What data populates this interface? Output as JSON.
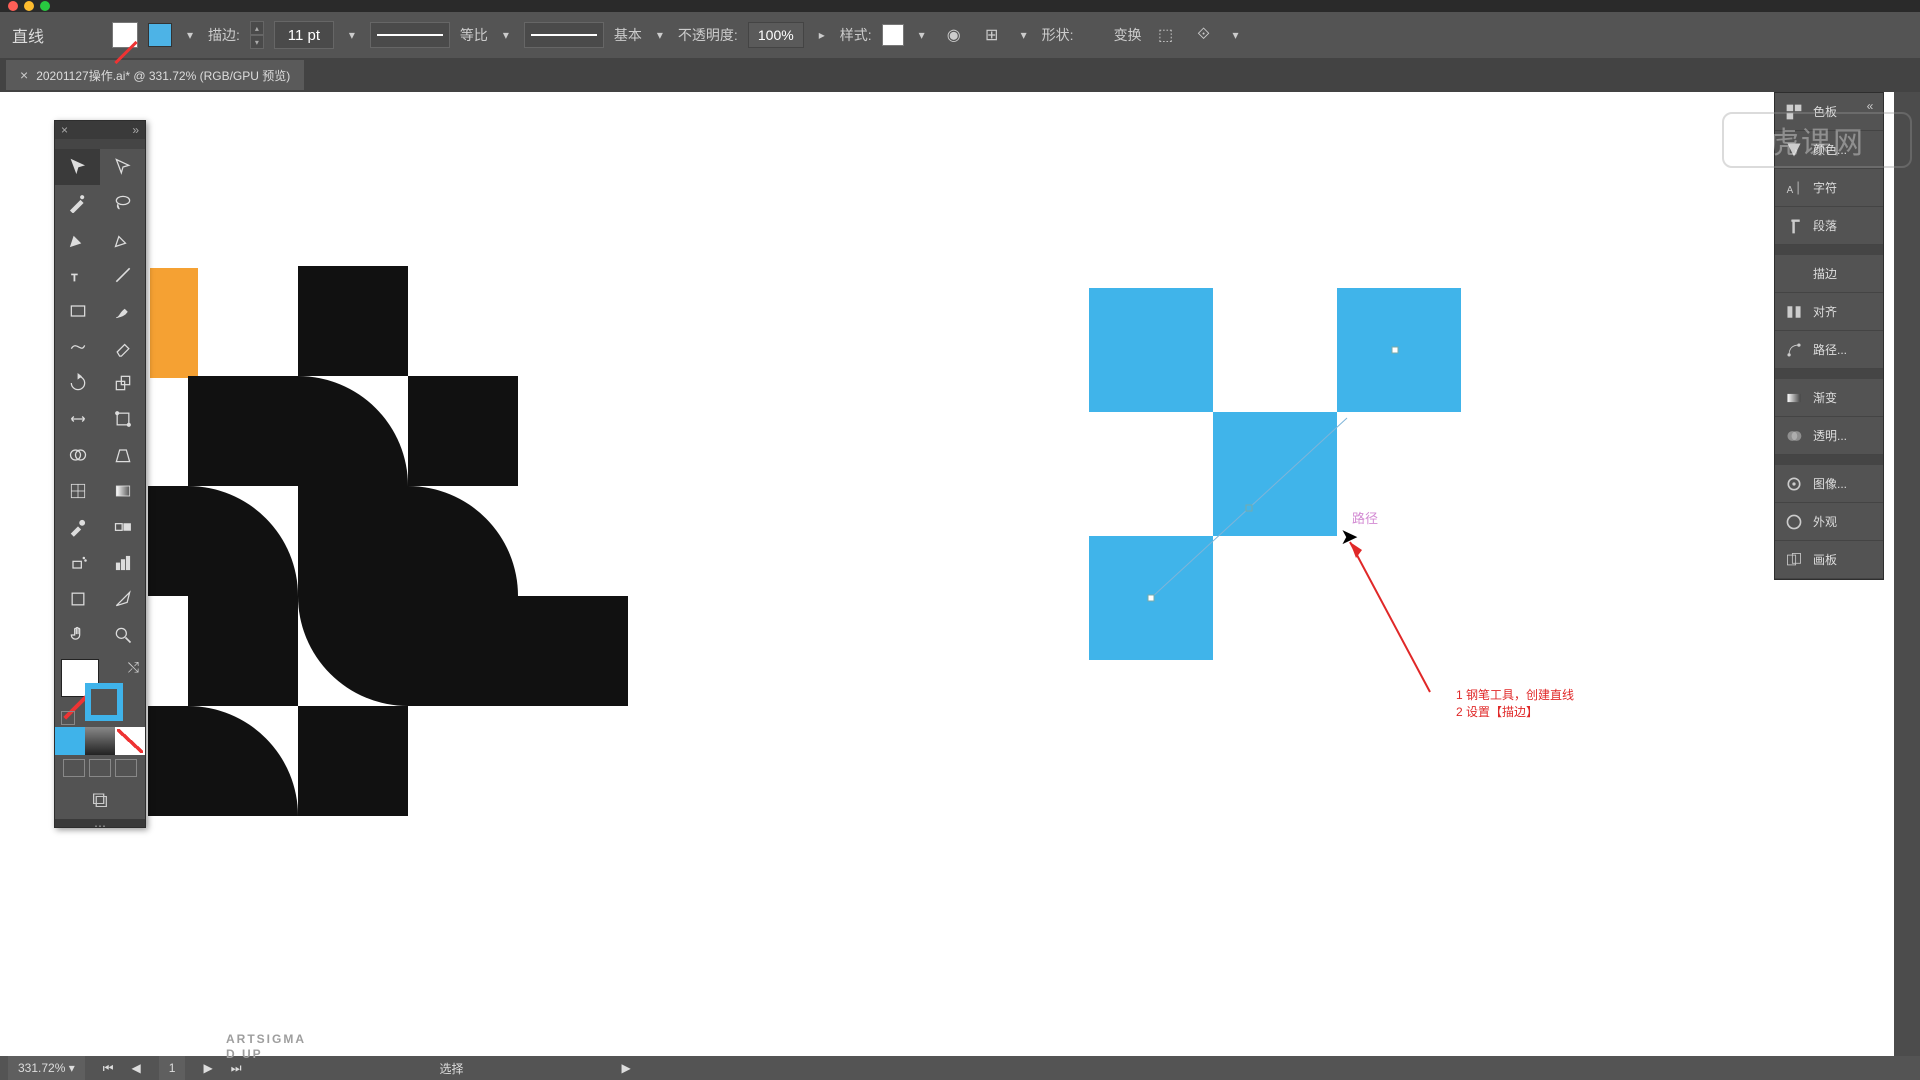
{
  "titlebar": {
    "dots": [
      "#ff5f57",
      "#febc2e",
      "#28c840"
    ]
  },
  "options": {
    "tool_label": "直线",
    "stroke_label": "描边:",
    "stroke_value": "11 pt",
    "dash_label": "等比",
    "profile_label": "基本",
    "opacity_label": "不透明度:",
    "opacity_value": "100%",
    "style_label": "样式:",
    "shape_label": "形状:",
    "transform_label": "变换"
  },
  "tab": {
    "title": "20201127操作.ai* @ 331.72% (RGB/GPU 预览)"
  },
  "toolbox_header": {
    "x": "×",
    "menu": "»"
  },
  "right_panel": [
    {
      "icon": "swatches",
      "label": "色板"
    },
    {
      "icon": "color",
      "label": "颜色..."
    },
    {
      "icon": "char",
      "label": "字符"
    },
    {
      "icon": "para",
      "label": "段落"
    },
    {
      "sep": true
    },
    {
      "icon": "stroke",
      "label": "描边"
    },
    {
      "icon": "align",
      "label": "对齐"
    },
    {
      "icon": "path",
      "label": "路径..."
    },
    {
      "sep": true
    },
    {
      "icon": "grad",
      "label": "渐变"
    },
    {
      "icon": "trans",
      "label": "透明..."
    },
    {
      "sep": true
    },
    {
      "icon": "img",
      "label": "图像..."
    },
    {
      "icon": "appear",
      "label": "外观"
    },
    {
      "icon": "artb",
      "label": "画板"
    }
  ],
  "status": {
    "zoom": "331.72%",
    "artboard": "1",
    "mode": "选择"
  },
  "canvas": {
    "text_line1": "ARTSIGMA",
    "text_line2": "D UP",
    "hint": "路径",
    "anno_line1": "1 钢笔工具，创建直线",
    "anno_line2": "2 设置【描边】"
  },
  "watermark": "虎课网"
}
